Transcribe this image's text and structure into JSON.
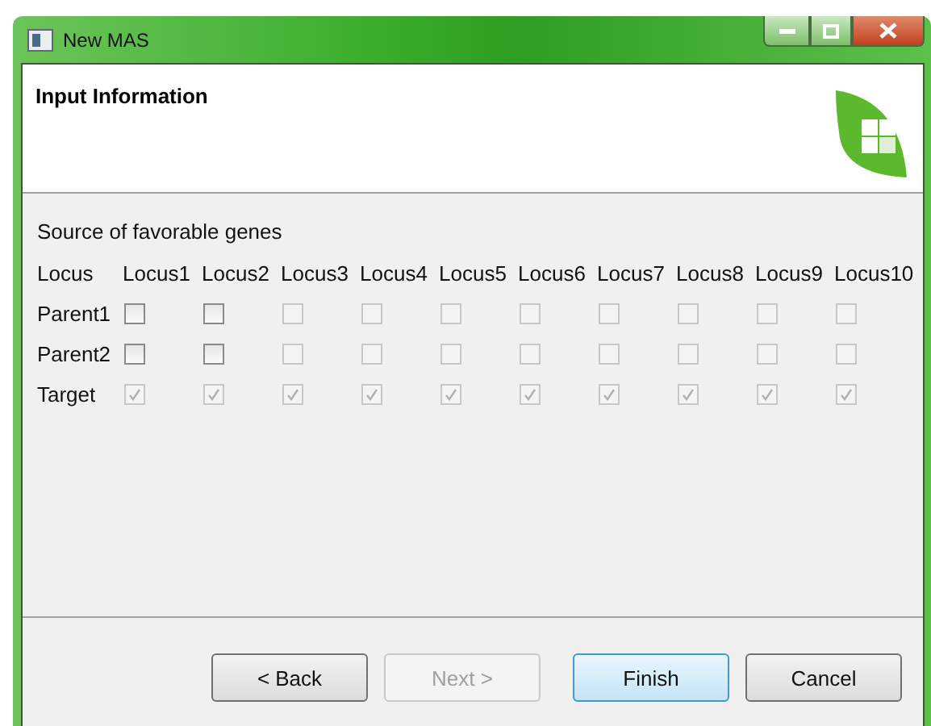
{
  "window": {
    "title": "New MAS"
  },
  "header": {
    "title": "Input Information"
  },
  "section_label": "Source of favorable genes",
  "columns": [
    "Locus",
    "Locus1",
    "Locus2",
    "Locus3",
    "Locus4",
    "Locus5",
    "Locus6",
    "Locus7",
    "Locus8",
    "Locus9",
    "Locus10"
  ],
  "rows": [
    {
      "label": "Parent1",
      "cells": [
        {
          "checked": false,
          "disabled": false
        },
        {
          "checked": false,
          "disabled": false
        },
        {
          "checked": false,
          "disabled": true
        },
        {
          "checked": false,
          "disabled": true
        },
        {
          "checked": false,
          "disabled": true
        },
        {
          "checked": false,
          "disabled": true
        },
        {
          "checked": false,
          "disabled": true
        },
        {
          "checked": false,
          "disabled": true
        },
        {
          "checked": false,
          "disabled": true
        },
        {
          "checked": false,
          "disabled": true
        }
      ]
    },
    {
      "label": "Parent2",
      "cells": [
        {
          "checked": false,
          "disabled": false
        },
        {
          "checked": false,
          "disabled": false
        },
        {
          "checked": false,
          "disabled": true
        },
        {
          "checked": false,
          "disabled": true
        },
        {
          "checked": false,
          "disabled": true
        },
        {
          "checked": false,
          "disabled": true
        },
        {
          "checked": false,
          "disabled": true
        },
        {
          "checked": false,
          "disabled": true
        },
        {
          "checked": false,
          "disabled": true
        },
        {
          "checked": false,
          "disabled": true
        }
      ]
    },
    {
      "label": "Target",
      "cells": [
        {
          "checked": true,
          "disabled": true
        },
        {
          "checked": true,
          "disabled": true
        },
        {
          "checked": true,
          "disabled": true
        },
        {
          "checked": true,
          "disabled": true
        },
        {
          "checked": true,
          "disabled": true
        },
        {
          "checked": true,
          "disabled": true
        },
        {
          "checked": true,
          "disabled": true
        },
        {
          "checked": true,
          "disabled": true
        },
        {
          "checked": true,
          "disabled": true
        },
        {
          "checked": true,
          "disabled": true
        }
      ]
    }
  ],
  "buttons": [
    {
      "label": "< Back",
      "disabled": false,
      "default": false
    },
    {
      "label": "Next >",
      "disabled": true,
      "default": false
    },
    {
      "label": "Finish",
      "disabled": false,
      "default": true
    },
    {
      "label": "Cancel",
      "disabled": false,
      "default": false
    }
  ]
}
